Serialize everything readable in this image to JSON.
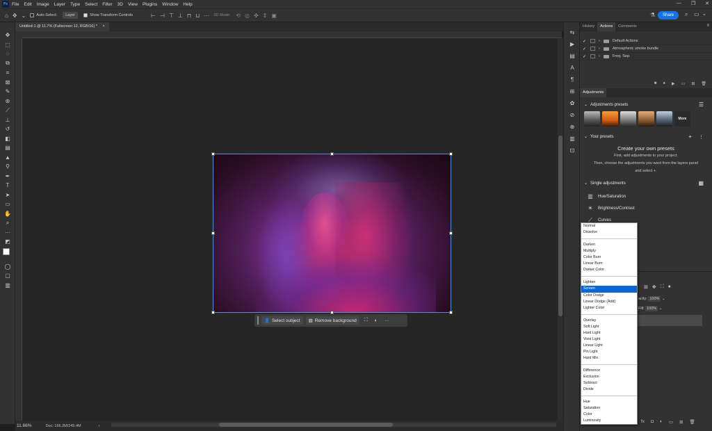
{
  "app": {
    "logo": "Ps"
  },
  "menu": [
    "File",
    "Edit",
    "Image",
    "Layer",
    "Type",
    "Select",
    "Filter",
    "3D",
    "View",
    "Plugins",
    "Window",
    "Help"
  ],
  "window_controls": [
    "—",
    "❐",
    "✕"
  ],
  "options_bar": {
    "auto_select_label": "Auto-Select:",
    "auto_select_value": "Layer",
    "show_transform_label": "Show Transform Controls",
    "mode_3d_label": "3D Mode:",
    "share_label": "Share"
  },
  "document_tab": {
    "title": "Untitled-1 @ 11.7% (Fullscreen 12, RGB/16) *",
    "close": "×"
  },
  "status": {
    "zoom": "11.66%",
    "doc_info": "Doc: 166.2M/245.4M"
  },
  "context_bar": {
    "select_subject": "Select subject",
    "remove_background": "Remove background",
    "more": "···"
  },
  "panels": {
    "tabs": [
      "History",
      "Actions",
      "Comments"
    ],
    "active_tab": "Actions",
    "actions": [
      {
        "check": "✓",
        "label": "Default Actions"
      },
      {
        "check": "✓",
        "label": "Atmospheric smoke bundle"
      },
      {
        "check": "✓",
        "label": "Freq. Sep."
      }
    ],
    "adjustments_tab": "Adjustments",
    "presets_header": "Adjustments presets",
    "presets_more": "More",
    "your_presets_header": "Your presets",
    "create_title": "Create your own presets",
    "create_line1": "First, add adjustments to your project.",
    "create_line2": "Then, choose the adjustments you want from the layers panel",
    "create_line3": "and select",
    "single_adjustments_header": "Single adjustments",
    "single_adjustments": [
      "Hue/Saturation",
      "Brightness/Contrast",
      "Curves"
    ]
  },
  "layers": {
    "opacity_label": "acity:",
    "opacity_value": "100%",
    "fill_label": "Fill:",
    "fill_value": "100%"
  },
  "blend_modes": [
    {
      "label": "Normal"
    },
    {
      "label": "Dissolve"
    },
    {
      "sep": true
    },
    {
      "label": "Darken"
    },
    {
      "label": "Multiply"
    },
    {
      "label": "Color Burn"
    },
    {
      "label": "Linear Burn"
    },
    {
      "label": "Darker Color"
    },
    {
      "sep": true
    },
    {
      "label": "Lighten"
    },
    {
      "label": "Screen",
      "selected": true
    },
    {
      "label": "Color Dodge"
    },
    {
      "label": "Linear Dodge (Add)"
    },
    {
      "label": "Lighter Color"
    },
    {
      "sep": true
    },
    {
      "label": "Overlay"
    },
    {
      "label": "Soft Light"
    },
    {
      "label": "Hard Light"
    },
    {
      "label": "Vivid Light"
    },
    {
      "label": "Linear Light"
    },
    {
      "label": "Pin Light"
    },
    {
      "label": "Hard Mix"
    },
    {
      "sep": true
    },
    {
      "label": "Difference"
    },
    {
      "label": "Exclusion"
    },
    {
      "label": "Subtract"
    },
    {
      "label": "Divide"
    },
    {
      "sep": true
    },
    {
      "label": "Hue"
    },
    {
      "label": "Saturation"
    },
    {
      "label": "Color"
    },
    {
      "label": "Luminosity"
    }
  ],
  "colors": {
    "accent": "#1473e6",
    "selection": "#0a64d2"
  }
}
